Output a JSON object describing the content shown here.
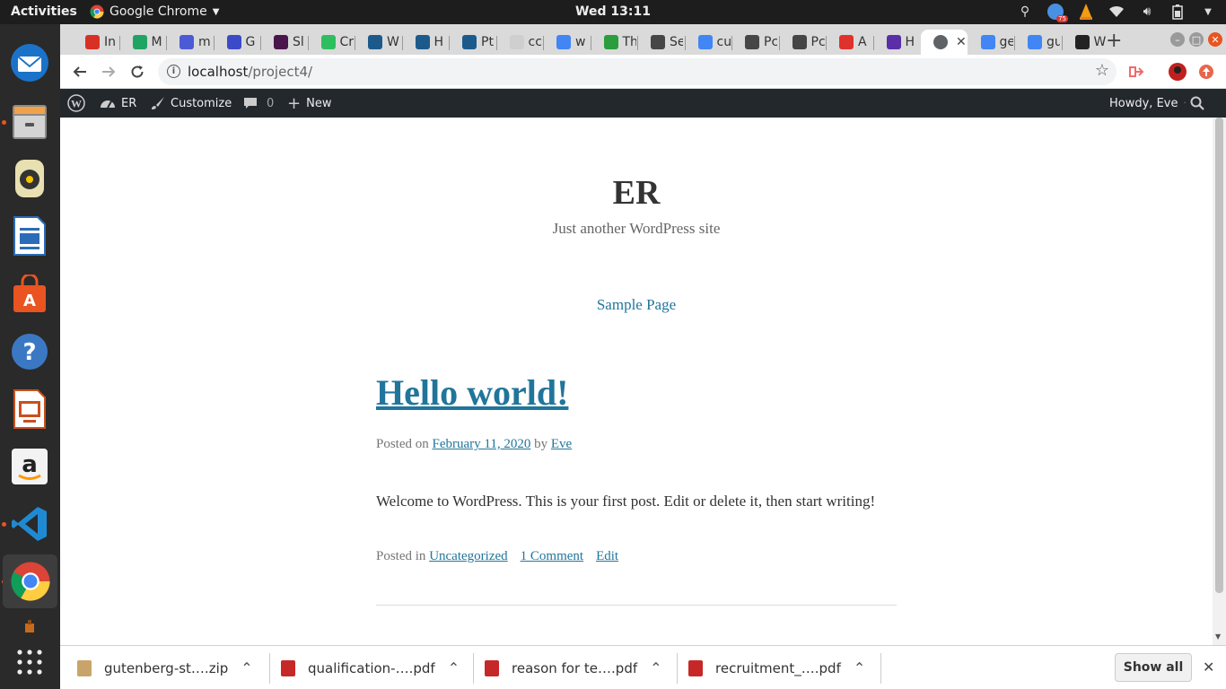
{
  "os": {
    "activities": "Activities",
    "app_menu": "Google Chrome",
    "clock": "Wed 13:11",
    "battery_badge": "75"
  },
  "browser": {
    "tabs": [
      {
        "label": "In",
        "icon": "gmail-icon",
        "color": "#d93025"
      },
      {
        "label": "M",
        "icon": "drive-icon",
        "color": "#1fa463"
      },
      {
        "label": "m",
        "icon": "docs-icon",
        "color": "#4b5bd6"
      },
      {
        "label": "G",
        "icon": "calendar-icon",
        "color": "#3b4bc8"
      },
      {
        "label": "Sl",
        "icon": "slack-icon",
        "color": "#4a154b"
      },
      {
        "label": "Cr",
        "icon": "evernote-icon",
        "color": "#2dbe60"
      },
      {
        "label": "W",
        "icon": "app-icon",
        "color": "#1d5a8c"
      },
      {
        "label": "H",
        "icon": "app-icon",
        "color": "#1d5a8c"
      },
      {
        "label": "Pt",
        "icon": "app-icon",
        "color": "#1d5a8c"
      },
      {
        "label": "cc",
        "icon": "circle-icon",
        "color": "#cfcfcf"
      },
      {
        "label": "w",
        "icon": "google-icon",
        "color": "#4285f4"
      },
      {
        "label": "Th",
        "icon": "presentation-icon",
        "color": "#2a9d3c"
      },
      {
        "label": "Se",
        "icon": "wordpress-icon",
        "color": "#464646"
      },
      {
        "label": "cu",
        "icon": "google-icon",
        "color": "#4285f4"
      },
      {
        "label": "Pc",
        "icon": "wordpress-icon",
        "color": "#464646"
      },
      {
        "label": "Pc",
        "icon": "wordpress-icon",
        "color": "#464646"
      },
      {
        "label": "A",
        "icon": "s-icon",
        "color": "#e0322d"
      },
      {
        "label": "H",
        "icon": "hat-icon",
        "color": "#5a2ea6"
      },
      {
        "label": "",
        "icon": "globe-icon",
        "color": "#5f6368",
        "active": true
      },
      {
        "label": "ge",
        "icon": "google-icon",
        "color": "#4285f4"
      },
      {
        "label": "gu",
        "icon": "google-icon",
        "color": "#4285f4"
      },
      {
        "label": "W",
        "icon": "github-icon",
        "color": "#222222"
      }
    ],
    "url_host": "localhost",
    "url_path": "/project4/"
  },
  "wp_admin": {
    "site_name": "ER",
    "customize": "Customize",
    "comments_count": "0",
    "new": "New",
    "howdy": "Howdy, Eve"
  },
  "page": {
    "site_title": "ER",
    "site_description": "Just another WordPress site",
    "menu_item": "Sample Page",
    "post": {
      "title": "Hello world!",
      "posted_on": "Posted on",
      "date": "February 11, 2020",
      "by": "by",
      "author": "Eve",
      "body": "Welcome to WordPress. This is your first post. Edit or delete it, then start writing!",
      "posted_in": "Posted in",
      "category": "Uncategorized",
      "comments": "1 Comment",
      "edit": "Edit"
    }
  },
  "downloads": [
    {
      "name": "gutenberg-st….zip",
      "type": "zip"
    },
    {
      "name": "qualification-….pdf",
      "type": "pdf"
    },
    {
      "name": "reason for te….pdf",
      "type": "pdf"
    },
    {
      "name": "recruitment_….pdf",
      "type": "pdf"
    }
  ],
  "show_all": "Show all",
  "colors": {
    "wp_link": "#21759b",
    "admin_bar": "#23282d",
    "ubuntu_accent": "#e95420"
  }
}
